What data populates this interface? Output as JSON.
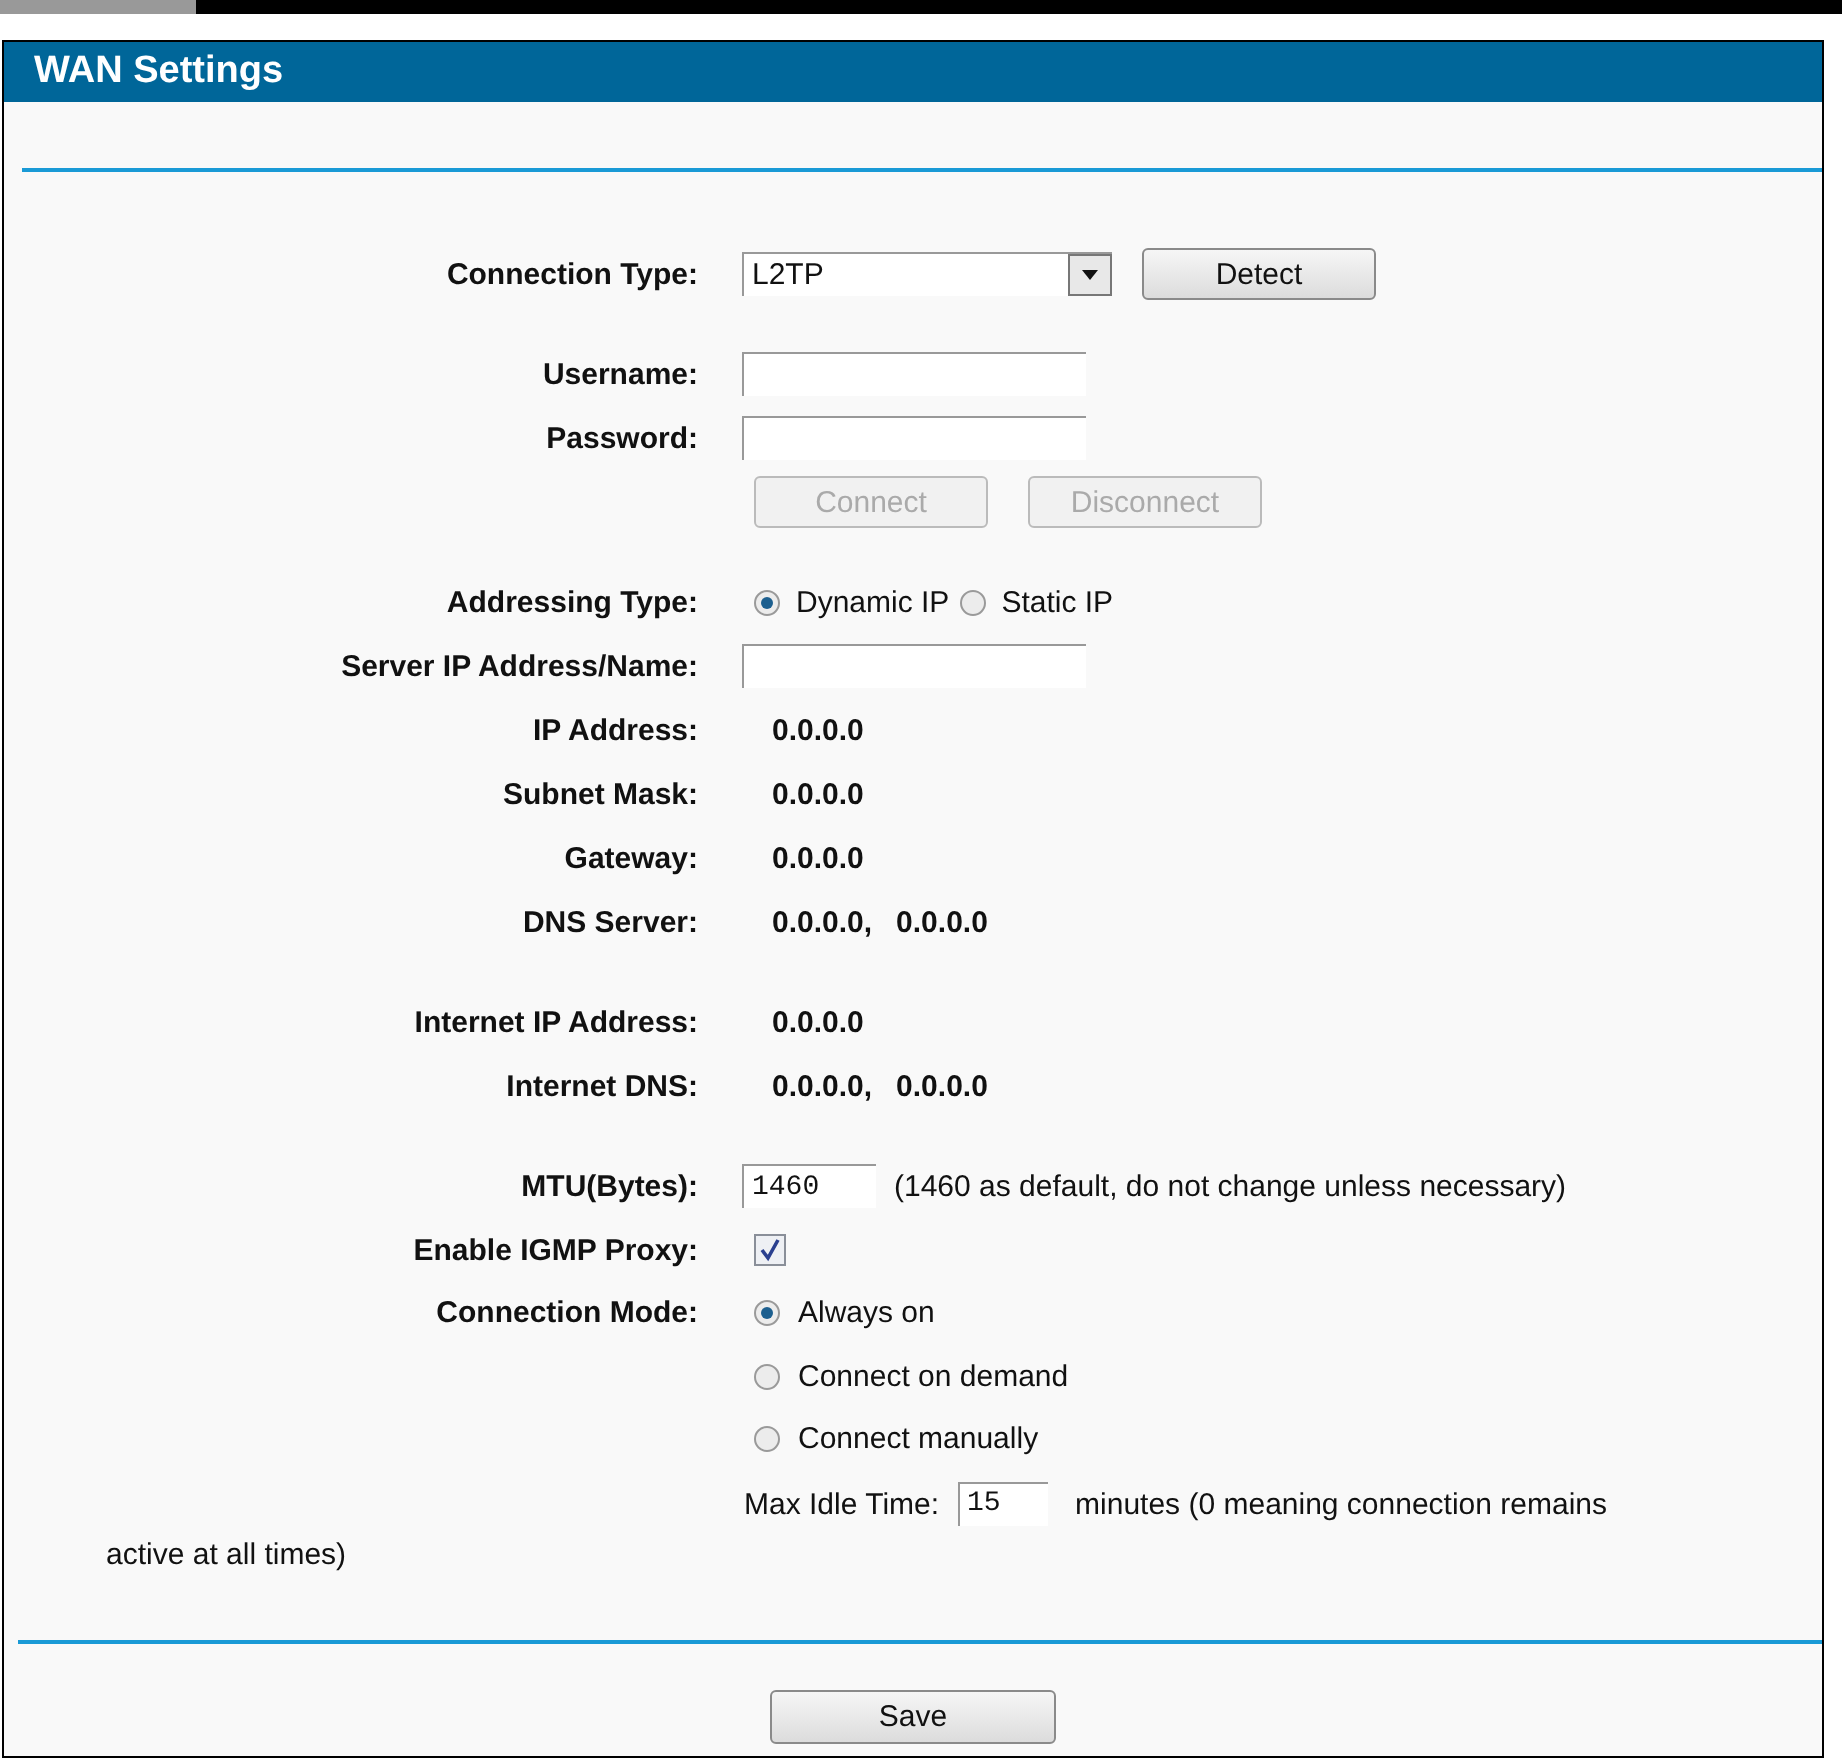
{
  "header": {
    "title": "WAN Settings"
  },
  "sections": [
    [
      {
        "kind": "select",
        "label": "Connection Type:",
        "value": "L2TP",
        "button": {
          "label": "Detect",
          "disabled": false
        }
      }
    ],
    [
      {
        "kind": "input",
        "label": "Username:"
      },
      {
        "kind": "input",
        "label": "Password:"
      },
      {
        "kind": "buttons",
        "buttons": [
          {
            "label": "Connect",
            "disabled": true
          },
          {
            "label": "Disconnect",
            "disabled": true
          }
        ]
      }
    ],
    [
      {
        "kind": "radios",
        "label": "Addressing Type:",
        "options": [
          {
            "label": "Dynamic IP",
            "selected": true
          },
          {
            "label": "Static IP",
            "selected": false
          }
        ]
      },
      {
        "kind": "input",
        "label": "Server IP Address/Name:"
      },
      {
        "kind": "value",
        "label": "IP Address:",
        "values": [
          "0.0.0.0"
        ]
      },
      {
        "kind": "value",
        "label": "Subnet Mask:",
        "values": [
          "0.0.0.0"
        ]
      },
      {
        "kind": "value",
        "label": "Gateway:",
        "values": [
          "0.0.0.0"
        ]
      },
      {
        "kind": "value",
        "label": "DNS Server:",
        "values": [
          "0.0.0.0,",
          "0.0.0.0"
        ]
      }
    ],
    [
      {
        "kind": "value",
        "label": "Internet IP Address:",
        "values": [
          "0.0.0.0"
        ]
      },
      {
        "kind": "value",
        "label": "Internet DNS:",
        "values": [
          "0.0.0.0,",
          "0.0.0.0"
        ]
      }
    ],
    [
      {
        "kind": "input",
        "label": "MTU(Bytes):",
        "value": "1460",
        "note": "(1460 as default, do not change unless necessary)"
      },
      {
        "kind": "checkbox",
        "label": "Enable IGMP Proxy:",
        "checked": true
      },
      {
        "kind": "radio_list",
        "label": "Connection Mode:",
        "options": [
          {
            "label": "Always on",
            "selected": true
          },
          {
            "label": "Connect on demand",
            "selected": false
          },
          {
            "label": "Connect manually",
            "selected": false
          }
        ]
      },
      {
        "kind": "idle",
        "label": "Max Idle Time:",
        "value": "15",
        "note": "minutes (0 meaning connection remains",
        "note_continued": "active at all times)"
      }
    ]
  ],
  "save_button": {
    "label": "Save"
  }
}
